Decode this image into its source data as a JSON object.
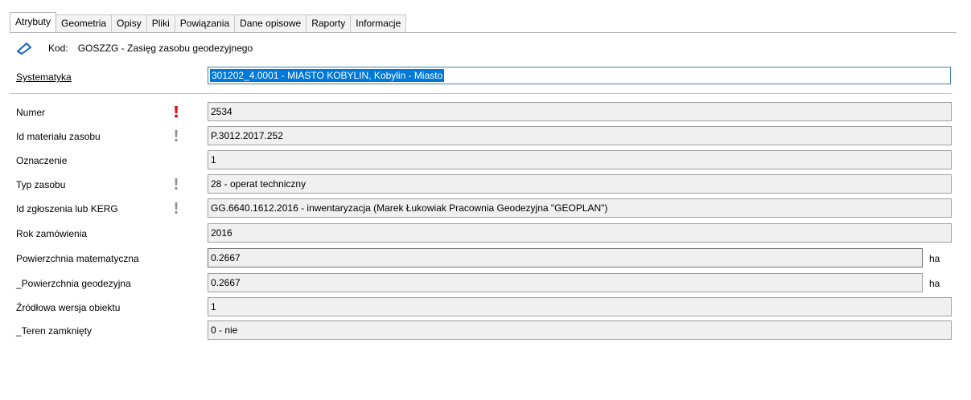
{
  "tabs": [
    "Atrybuty",
    "Geometria",
    "Opisy",
    "Pliki",
    "Powiązania",
    "Dane opisowe",
    "Raporty",
    "Informacje"
  ],
  "header": {
    "icon": "polygon-outline-icon",
    "kod_label": "Kod:",
    "kod_value": "GOSZZG - Zasięg zasobu geodezyjnego"
  },
  "systematyka": {
    "label": "Systematyka",
    "value": "301202_4.0001 - MIASTO KOBYLIN, Kobylin - Miasto"
  },
  "fields": [
    {
      "label": "Numer",
      "value": "2534",
      "indicator": "required-red"
    },
    {
      "label": "Id materiału zasobu",
      "value": "P.3012.2017.252",
      "indicator": "required-grey"
    },
    {
      "label": "Oznaczenie",
      "value": "1",
      "indicator": ""
    },
    {
      "label": "Typ zasobu",
      "value": "28 - operat techniczny",
      "indicator": "required-grey"
    },
    {
      "label": "Id zgłoszenia lub KERG",
      "value": "GG.6640.1612.2016 - inwentaryzacja (Marek Łukowiak Pracownia Geodezyjna \"GEOPLAN\")",
      "indicator": "required-grey"
    },
    {
      "label": "Rok zamówienia",
      "value": "2016",
      "indicator": ""
    },
    {
      "label": "Powierzchnia matematyczna",
      "value": "0.2667",
      "indicator": "",
      "unit": "ha"
    },
    {
      "label": "_Powierzchnia geodezyjna",
      "value": "0.2667",
      "indicator": "",
      "unit": "ha"
    },
    {
      "label": "Źródłowa wersja obiektu",
      "value": "1",
      "indicator": ""
    },
    {
      "label": "_Teren zamknięty",
      "value": "0 - nie",
      "indicator": ""
    }
  ],
  "colors": {
    "required_red": "#e81123",
    "required_grey": "#8c8c8c",
    "selection": "#0078d7",
    "icon_blue": "#1565c0"
  }
}
